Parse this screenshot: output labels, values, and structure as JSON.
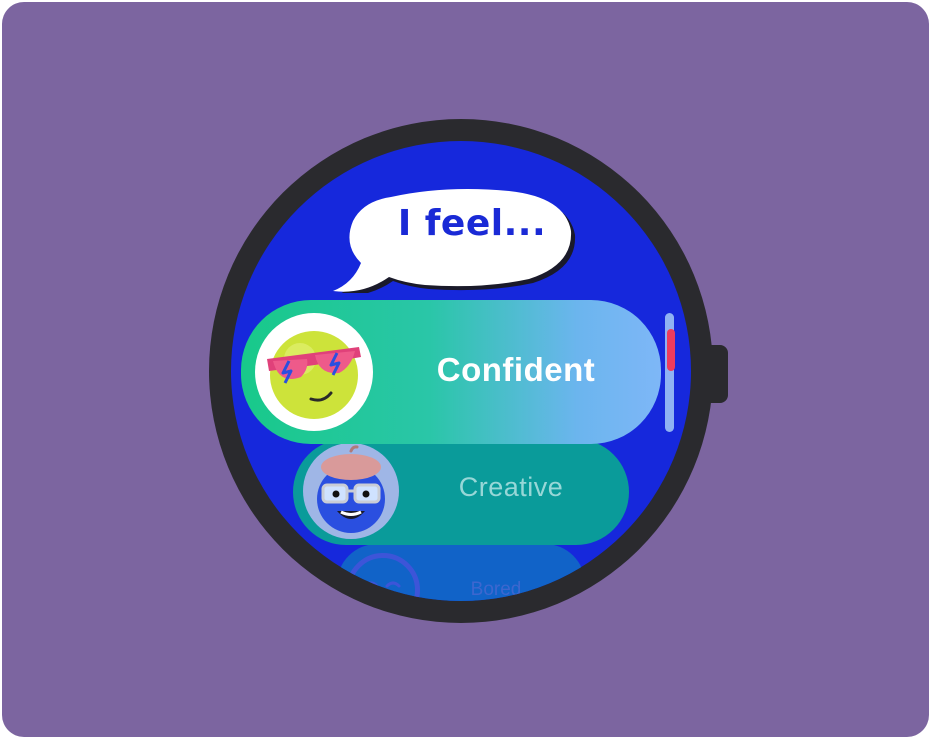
{
  "prompt": "I feel...",
  "moods": [
    {
      "label": "Confident",
      "icon": "cool-sunglasses-face-icon",
      "selected": true
    },
    {
      "label": "Creative",
      "icon": "artist-beret-face-icon",
      "selected": false
    },
    {
      "label": "Bored",
      "icon": "bored-face-icon",
      "selected": false
    }
  ],
  "scroll": {
    "position": 0.2
  },
  "colors": {
    "background": "#7c65a0",
    "bezel": "#2a2a2e",
    "screen": "#1628dc",
    "accent_scroll": "#ee3b5d"
  }
}
